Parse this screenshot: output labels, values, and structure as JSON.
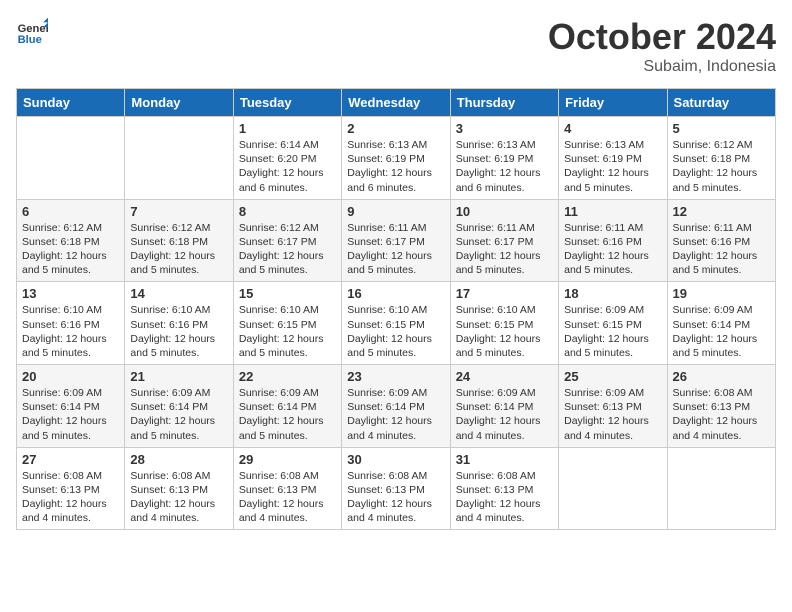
{
  "header": {
    "logo_general": "General",
    "logo_blue": "Blue",
    "month_title": "October 2024",
    "location": "Subaim, Indonesia"
  },
  "weekdays": [
    "Sunday",
    "Monday",
    "Tuesday",
    "Wednesday",
    "Thursday",
    "Friday",
    "Saturday"
  ],
  "weeks": [
    [
      {
        "day": "",
        "text": ""
      },
      {
        "day": "",
        "text": ""
      },
      {
        "day": "1",
        "text": "Sunrise: 6:14 AM\nSunset: 6:20 PM\nDaylight: 12 hours\nand 6 minutes."
      },
      {
        "day": "2",
        "text": "Sunrise: 6:13 AM\nSunset: 6:19 PM\nDaylight: 12 hours\nand 6 minutes."
      },
      {
        "day": "3",
        "text": "Sunrise: 6:13 AM\nSunset: 6:19 PM\nDaylight: 12 hours\nand 6 minutes."
      },
      {
        "day": "4",
        "text": "Sunrise: 6:13 AM\nSunset: 6:19 PM\nDaylight: 12 hours\nand 5 minutes."
      },
      {
        "day": "5",
        "text": "Sunrise: 6:12 AM\nSunset: 6:18 PM\nDaylight: 12 hours\nand 5 minutes."
      }
    ],
    [
      {
        "day": "6",
        "text": "Sunrise: 6:12 AM\nSunset: 6:18 PM\nDaylight: 12 hours\nand 5 minutes."
      },
      {
        "day": "7",
        "text": "Sunrise: 6:12 AM\nSunset: 6:18 PM\nDaylight: 12 hours\nand 5 minutes."
      },
      {
        "day": "8",
        "text": "Sunrise: 6:12 AM\nSunset: 6:17 PM\nDaylight: 12 hours\nand 5 minutes."
      },
      {
        "day": "9",
        "text": "Sunrise: 6:11 AM\nSunset: 6:17 PM\nDaylight: 12 hours\nand 5 minutes."
      },
      {
        "day": "10",
        "text": "Sunrise: 6:11 AM\nSunset: 6:17 PM\nDaylight: 12 hours\nand 5 minutes."
      },
      {
        "day": "11",
        "text": "Sunrise: 6:11 AM\nSunset: 6:16 PM\nDaylight: 12 hours\nand 5 minutes."
      },
      {
        "day": "12",
        "text": "Sunrise: 6:11 AM\nSunset: 6:16 PM\nDaylight: 12 hours\nand 5 minutes."
      }
    ],
    [
      {
        "day": "13",
        "text": "Sunrise: 6:10 AM\nSunset: 6:16 PM\nDaylight: 12 hours\nand 5 minutes."
      },
      {
        "day": "14",
        "text": "Sunrise: 6:10 AM\nSunset: 6:16 PM\nDaylight: 12 hours\nand 5 minutes."
      },
      {
        "day": "15",
        "text": "Sunrise: 6:10 AM\nSunset: 6:15 PM\nDaylight: 12 hours\nand 5 minutes."
      },
      {
        "day": "16",
        "text": "Sunrise: 6:10 AM\nSunset: 6:15 PM\nDaylight: 12 hours\nand 5 minutes."
      },
      {
        "day": "17",
        "text": "Sunrise: 6:10 AM\nSunset: 6:15 PM\nDaylight: 12 hours\nand 5 minutes."
      },
      {
        "day": "18",
        "text": "Sunrise: 6:09 AM\nSunset: 6:15 PM\nDaylight: 12 hours\nand 5 minutes."
      },
      {
        "day": "19",
        "text": "Sunrise: 6:09 AM\nSunset: 6:14 PM\nDaylight: 12 hours\nand 5 minutes."
      }
    ],
    [
      {
        "day": "20",
        "text": "Sunrise: 6:09 AM\nSunset: 6:14 PM\nDaylight: 12 hours\nand 5 minutes."
      },
      {
        "day": "21",
        "text": "Sunrise: 6:09 AM\nSunset: 6:14 PM\nDaylight: 12 hours\nand 5 minutes."
      },
      {
        "day": "22",
        "text": "Sunrise: 6:09 AM\nSunset: 6:14 PM\nDaylight: 12 hours\nand 5 minutes."
      },
      {
        "day": "23",
        "text": "Sunrise: 6:09 AM\nSunset: 6:14 PM\nDaylight: 12 hours\nand 4 minutes."
      },
      {
        "day": "24",
        "text": "Sunrise: 6:09 AM\nSunset: 6:14 PM\nDaylight: 12 hours\nand 4 minutes."
      },
      {
        "day": "25",
        "text": "Sunrise: 6:09 AM\nSunset: 6:13 PM\nDaylight: 12 hours\nand 4 minutes."
      },
      {
        "day": "26",
        "text": "Sunrise: 6:08 AM\nSunset: 6:13 PM\nDaylight: 12 hours\nand 4 minutes."
      }
    ],
    [
      {
        "day": "27",
        "text": "Sunrise: 6:08 AM\nSunset: 6:13 PM\nDaylight: 12 hours\nand 4 minutes."
      },
      {
        "day": "28",
        "text": "Sunrise: 6:08 AM\nSunset: 6:13 PM\nDaylight: 12 hours\nand 4 minutes."
      },
      {
        "day": "29",
        "text": "Sunrise: 6:08 AM\nSunset: 6:13 PM\nDaylight: 12 hours\nand 4 minutes."
      },
      {
        "day": "30",
        "text": "Sunrise: 6:08 AM\nSunset: 6:13 PM\nDaylight: 12 hours\nand 4 minutes."
      },
      {
        "day": "31",
        "text": "Sunrise: 6:08 AM\nSunset: 6:13 PM\nDaylight: 12 hours\nand 4 minutes."
      },
      {
        "day": "",
        "text": ""
      },
      {
        "day": "",
        "text": ""
      }
    ]
  ]
}
